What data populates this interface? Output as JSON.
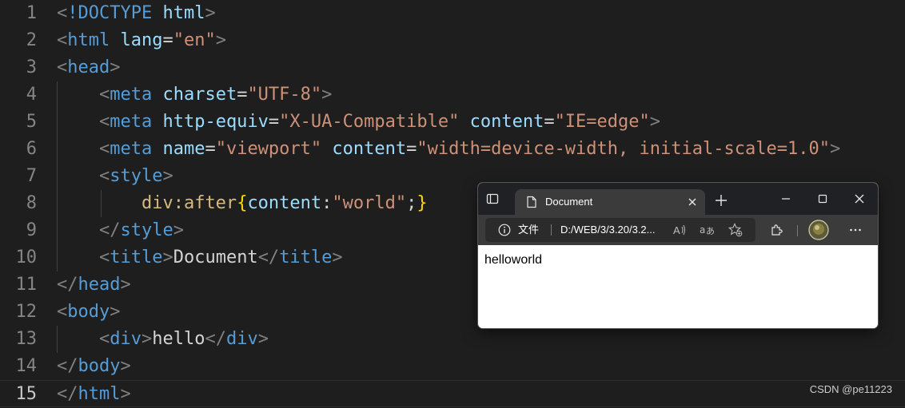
{
  "editor": {
    "lines": [
      {
        "num": "1",
        "tokens": [
          [
            "punc",
            "<"
          ],
          [
            "tag",
            "!DOCTYPE"
          ],
          [
            "txt",
            " "
          ],
          [
            "attr",
            "html"
          ],
          [
            "punc",
            ">"
          ]
        ]
      },
      {
        "num": "2",
        "tokens": [
          [
            "punc",
            "<"
          ],
          [
            "tag",
            "html"
          ],
          [
            "txt",
            " "
          ],
          [
            "attr",
            "lang"
          ],
          [
            "txt",
            "="
          ],
          [
            "str",
            "\"en\""
          ],
          [
            "punc",
            ">"
          ]
        ]
      },
      {
        "num": "3",
        "tokens": [
          [
            "punc",
            "<"
          ],
          [
            "tag",
            "head"
          ],
          [
            "punc",
            ">"
          ]
        ]
      },
      {
        "num": "4",
        "tokens": [
          [
            "txt",
            "    "
          ],
          [
            "punc",
            "<"
          ],
          [
            "tag",
            "meta"
          ],
          [
            "txt",
            " "
          ],
          [
            "attr",
            "charset"
          ],
          [
            "txt",
            "="
          ],
          [
            "str",
            "\"UTF-8\""
          ],
          [
            "punc",
            ">"
          ]
        ]
      },
      {
        "num": "5",
        "tokens": [
          [
            "txt",
            "    "
          ],
          [
            "punc",
            "<"
          ],
          [
            "tag",
            "meta"
          ],
          [
            "txt",
            " "
          ],
          [
            "attr",
            "http-equiv"
          ],
          [
            "txt",
            "="
          ],
          [
            "str",
            "\"X-UA-Compatible\""
          ],
          [
            "txt",
            " "
          ],
          [
            "attr",
            "content"
          ],
          [
            "txt",
            "="
          ],
          [
            "str",
            "\"IE=edge\""
          ],
          [
            "punc",
            ">"
          ]
        ]
      },
      {
        "num": "6",
        "tokens": [
          [
            "txt",
            "    "
          ],
          [
            "punc",
            "<"
          ],
          [
            "tag",
            "meta"
          ],
          [
            "txt",
            " "
          ],
          [
            "attr",
            "name"
          ],
          [
            "txt",
            "="
          ],
          [
            "str",
            "\"viewport\""
          ],
          [
            "txt",
            " "
          ],
          [
            "attr",
            "content"
          ],
          [
            "txt",
            "="
          ],
          [
            "str",
            "\"width=device-width, initial-scale=1.0\""
          ],
          [
            "punc",
            ">"
          ]
        ]
      },
      {
        "num": "7",
        "tokens": [
          [
            "txt",
            "    "
          ],
          [
            "punc",
            "<"
          ],
          [
            "tag",
            "style"
          ],
          [
            "punc",
            ">"
          ]
        ]
      },
      {
        "num": "8",
        "tokens": [
          [
            "txt",
            "        "
          ],
          [
            "sel",
            "div:after"
          ],
          [
            "brace",
            "{"
          ],
          [
            "prop",
            "content"
          ],
          [
            "txt",
            ":"
          ],
          [
            "str",
            "\"world\""
          ],
          [
            "txt",
            ";"
          ],
          [
            "brace",
            "}"
          ]
        ]
      },
      {
        "num": "9",
        "tokens": [
          [
            "txt",
            "    "
          ],
          [
            "punc",
            "</"
          ],
          [
            "tag",
            "style"
          ],
          [
            "punc",
            ">"
          ]
        ]
      },
      {
        "num": "10",
        "tokens": [
          [
            "txt",
            "    "
          ],
          [
            "punc",
            "<"
          ],
          [
            "tag",
            "title"
          ],
          [
            "punc",
            ">"
          ],
          [
            "txt",
            "Document"
          ],
          [
            "punc",
            "</"
          ],
          [
            "tag",
            "title"
          ],
          [
            "punc",
            ">"
          ]
        ]
      },
      {
        "num": "11",
        "tokens": [
          [
            "punc",
            "</"
          ],
          [
            "tag",
            "head"
          ],
          [
            "punc",
            ">"
          ]
        ]
      },
      {
        "num": "12",
        "tokens": [
          [
            "punc",
            "<"
          ],
          [
            "tag",
            "body"
          ],
          [
            "punc",
            ">"
          ]
        ]
      },
      {
        "num": "13",
        "tokens": [
          [
            "txt",
            "    "
          ],
          [
            "punc",
            "<"
          ],
          [
            "tag",
            "div"
          ],
          [
            "punc",
            ">"
          ],
          [
            "txt",
            "hello"
          ],
          [
            "punc",
            "</"
          ],
          [
            "tag",
            "div"
          ],
          [
            "punc",
            ">"
          ]
        ]
      },
      {
        "num": "14",
        "tokens": [
          [
            "punc",
            "</"
          ],
          [
            "tag",
            "body"
          ],
          [
            "punc",
            ">"
          ]
        ]
      },
      {
        "num": "15",
        "tokens": [
          [
            "punc",
            "</"
          ],
          [
            "tag",
            "html"
          ],
          [
            "punc",
            ">"
          ]
        ]
      }
    ],
    "active_line": "15"
  },
  "browser": {
    "tab_title": "Document",
    "file_label": "文件",
    "url": "D:/WEB/3/3.20/3.2...",
    "page_text": "helloworld",
    "icons": [
      "tab-actions-icon",
      "page-icon",
      "close-icon",
      "plus-icon",
      "minimize-icon",
      "maximize-icon",
      "close-window-icon",
      "info-icon",
      "read-aloud-icon",
      "translate-icon",
      "favorite-add-icon",
      "extensions-icon",
      "profile-avatar",
      "more-icon"
    ]
  },
  "watermark": "CSDN @pe11223",
  "colors": {
    "editor_bg": "#1e1e1e",
    "tag": "#569cd6",
    "attr": "#9cdcfe",
    "string": "#ce9178",
    "selector": "#d7ba7d",
    "brace": "#ffd700",
    "punctuation": "#808080"
  }
}
